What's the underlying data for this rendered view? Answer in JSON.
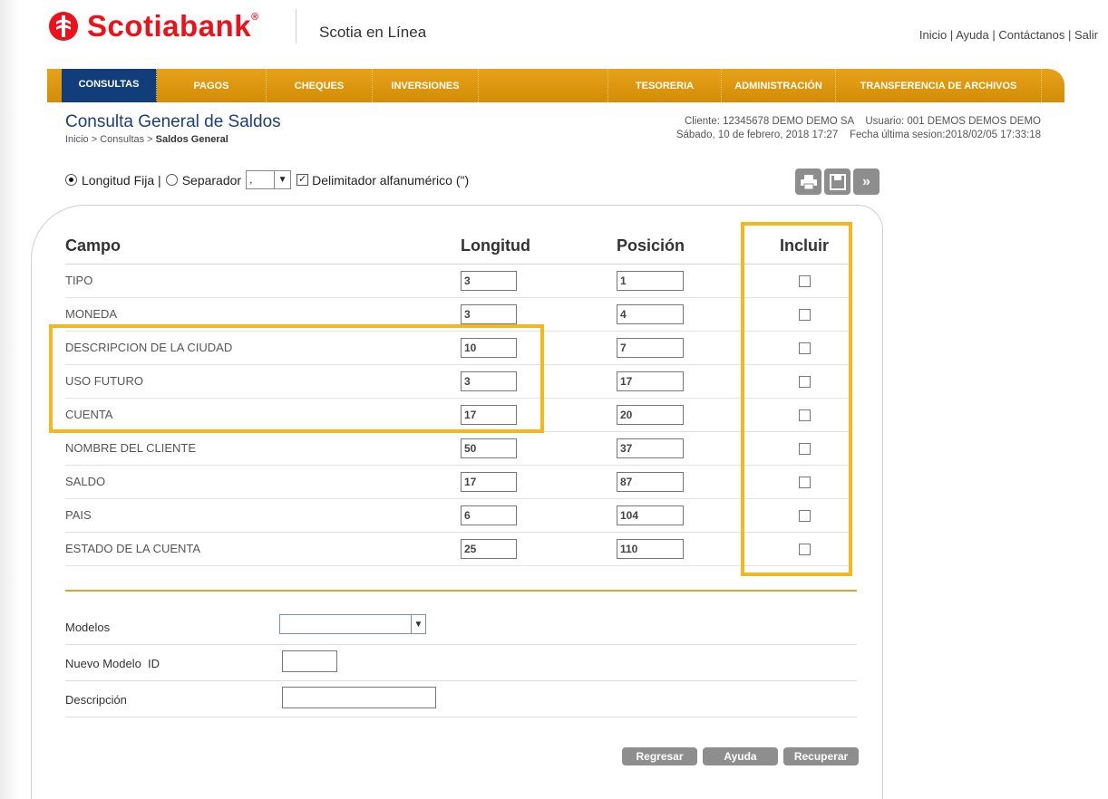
{
  "brand": {
    "name": "Scotiabank",
    "reg_mark": "®",
    "app_name": "Scotia en Línea",
    "brand_color": "#ec111a",
    "nav_color": "#e09a12",
    "nav_active_color": "#113e7a",
    "highlight_color": "#f4b81f"
  },
  "top_links": {
    "inicio": "Inicio",
    "ayuda": "Ayuda",
    "contacto": "Contáctanos",
    "salir": "Salir",
    "separator": " | "
  },
  "nav": {
    "consultas": "CONSULTAS",
    "pagos": "PAGOS",
    "cheques": "CHEQUES",
    "inversiones": "INVERSIONES",
    "tesoreria": "TESORERIA",
    "administracion": "ADMINISTRACIÓN",
    "transferencia": "TRANSFERENCIA DE ARCHIVOS"
  },
  "page": {
    "title": "Consulta General de Saldos",
    "breadcrumb_prefix": "Inicio > Consultas > ",
    "breadcrumb_current": "Saldos General",
    "client_line": "Cliente: 12345678 DEMO DEMO SA    Usuario: 001 DEMOS DEMOS DEMO",
    "date_line": "Sábado, 10 de febrero, 2018 17:27    Fecha última sesion:2018/02/05 17:33:18"
  },
  "format": {
    "fixed_label": "Longitud Fija |",
    "separator_label": "Separador",
    "separator_value": ",",
    "delimiter_label": "Delimitador alfanumérico (\")",
    "fixed_selected": true,
    "delimiter_checked": true
  },
  "toolbar_icons": [
    "print-icon",
    "save-icon",
    "forward-icon"
  ],
  "table": {
    "headers": {
      "campo": "Campo",
      "longitud": "Longitud",
      "posicion": "Posición",
      "incluir": "Incluir"
    },
    "rows": [
      {
        "campo": "TIPO",
        "longitud": "3",
        "posicion": "1"
      },
      {
        "campo": "MONEDA",
        "longitud": "3",
        "posicion": "4"
      },
      {
        "campo": "DESCRIPCION DE LA CIUDAD",
        "longitud": "10",
        "posicion": "7"
      },
      {
        "campo": "USO FUTURO",
        "longitud": "3",
        "posicion": "17"
      },
      {
        "campo": "CUENTA",
        "longitud": "17",
        "posicion": "20"
      },
      {
        "campo": "NOMBRE DEL CLIENTE",
        "longitud": "50",
        "posicion": "37"
      },
      {
        "campo": "SALDO",
        "longitud": "17",
        "posicion": "87"
      },
      {
        "campo": "PAIS",
        "longitud": "6",
        "posicion": "104"
      },
      {
        "campo": "ESTADO DE LA CUENTA",
        "longitud": "25",
        "posicion": "110"
      }
    ]
  },
  "form": {
    "modelos_label": "Modelos",
    "modelos_value": "",
    "nuevo_modelo_label": "Nuevo Modelo  ID",
    "nuevo_modelo_value": "",
    "descripcion_label": "Descripción",
    "descripcion_value": ""
  },
  "buttons": {
    "regresar": "Regresar",
    "ayuda": "Ayuda",
    "recuperar": "Recuperar"
  }
}
